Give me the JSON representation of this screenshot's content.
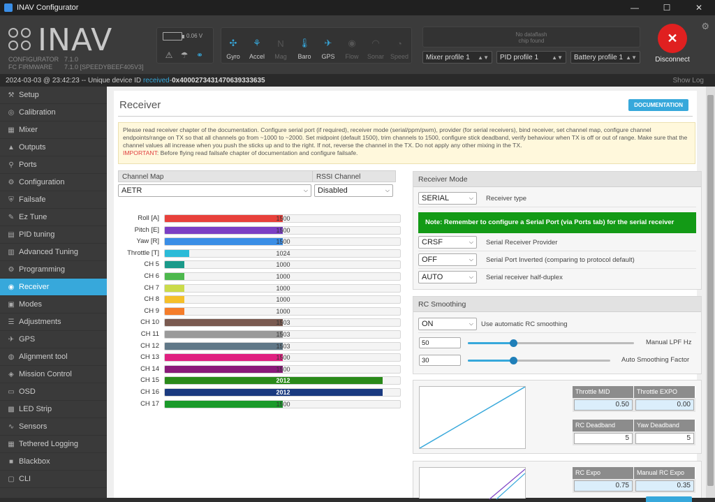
{
  "window": {
    "title": "INAV Configurator",
    "minimize": "—",
    "maximize": "☐",
    "close": "✕"
  },
  "header": {
    "brand": "INAV",
    "configurator_label": "CONFIGURATOR",
    "configurator_version": "7.1.0",
    "firmware_label": "FC FIRMWARE",
    "firmware_version": "7.1.0 [SPEEDYBEEF405V3]",
    "battery_voltage": "0.06 V",
    "sensors": [
      {
        "label": "Gyro",
        "icon": "gyro-icon",
        "state": "on"
      },
      {
        "label": "Accel",
        "icon": "accel-icon",
        "state": "on"
      },
      {
        "label": "Mag",
        "icon": "mag-icon",
        "state": "off"
      },
      {
        "label": "Baro",
        "icon": "baro-icon",
        "state": "on"
      },
      {
        "label": "GPS",
        "icon": "gps-icon",
        "state": "on"
      },
      {
        "label": "Flow",
        "icon": "flow-icon",
        "state": "off"
      },
      {
        "label": "Sonar",
        "icon": "sonar-icon",
        "state": "off"
      },
      {
        "label": "Speed",
        "icon": "speed-icon",
        "state": "off"
      }
    ],
    "dataflash_line1": "No dataflash",
    "dataflash_line2": "chip found",
    "mixer_profile": "Mixer profile 1",
    "pid_profile": "PID profile 1",
    "battery_profile": "Battery profile 1",
    "disconnect_label": "Disconnect"
  },
  "status": {
    "prefix": "2024-03-03 @ 23:42:23 -- Unique device ID ",
    "received": "received",
    "sep": " - ",
    "device_id": "0x4000273431470639333635",
    "show_log": "Show Log"
  },
  "sidebar": {
    "items": [
      {
        "label": "Setup",
        "icon": "wrench-icon",
        "glyph": "⚒"
      },
      {
        "label": "Calibration",
        "icon": "calibration-icon",
        "glyph": "◎"
      },
      {
        "label": "Mixer",
        "icon": "mixer-icon",
        "glyph": "▦"
      },
      {
        "label": "Outputs",
        "icon": "outputs-icon",
        "glyph": "▲"
      },
      {
        "label": "Ports",
        "icon": "ports-icon",
        "glyph": "⚲"
      },
      {
        "label": "Configuration",
        "icon": "gear-icon",
        "glyph": "⚙"
      },
      {
        "label": "Failsafe",
        "icon": "failsafe-icon",
        "glyph": "⛨"
      },
      {
        "label": "Ez Tune",
        "icon": "eztune-icon",
        "glyph": "✎"
      },
      {
        "label": "PID tuning",
        "icon": "pid-icon",
        "glyph": "▤"
      },
      {
        "label": "Advanced Tuning",
        "icon": "advanced-tuning-icon",
        "glyph": "▥"
      },
      {
        "label": "Programming",
        "icon": "programming-icon",
        "glyph": "⚙"
      },
      {
        "label": "Receiver",
        "icon": "receiver-icon",
        "glyph": "◉"
      },
      {
        "label": "Modes",
        "icon": "modes-icon",
        "glyph": "▣"
      },
      {
        "label": "Adjustments",
        "icon": "adjustments-icon",
        "glyph": "☰"
      },
      {
        "label": "GPS",
        "icon": "gps-icon",
        "glyph": "✈"
      },
      {
        "label": "Alignment tool",
        "icon": "alignment-icon",
        "glyph": "◍"
      },
      {
        "label": "Mission Control",
        "icon": "mission-icon",
        "glyph": "◈"
      },
      {
        "label": "OSD",
        "icon": "osd-icon",
        "glyph": "▭"
      },
      {
        "label": "LED Strip",
        "icon": "led-icon",
        "glyph": "▩"
      },
      {
        "label": "Sensors",
        "icon": "sensors-icon",
        "glyph": "∿"
      },
      {
        "label": "Tethered Logging",
        "icon": "tethered-logging-icon",
        "glyph": "▦"
      },
      {
        "label": "Blackbox",
        "icon": "blackbox-icon",
        "glyph": "■"
      },
      {
        "label": "CLI",
        "icon": "cli-icon",
        "glyph": "▢"
      }
    ],
    "active_index": 11
  },
  "receiver": {
    "title": "Receiver",
    "doc_button": "DOCUMENTATION",
    "notice": "Please read receiver chapter of the documentation. Configure serial port (if required), receiver mode (serial/ppm/pwm), provider (for serial receivers), bind receiver, set channel map, configure channel endpoints/range on TX so that all channels go from ~1000 to ~2000. Set midpoint (default 1500), trim channels to 1500, configure stick deadband, verify behaviour when TX is off or out of range. Make sure that the channel values all increase when you push the sticks up and to the right. If not, reverse the channel in the TX. Do not apply any other mixing in the TX.",
    "important_label": "IMPORTANT",
    "important_text": ": Before flying read failsafe chapter of documentation and configure failsafe.",
    "channel_map_label": "Channel Map",
    "channel_map_value": "AETR",
    "rssi_label": "RSSI Channel",
    "rssi_value": "Disabled",
    "channels": [
      {
        "label": "Roll [A]",
        "value": 1500,
        "color": "#e8413b"
      },
      {
        "label": "Pitch [E]",
        "value": 1500,
        "color": "#7b3fc4"
      },
      {
        "label": "Yaw [R]",
        "value": 1500,
        "color": "#3a8ee6"
      },
      {
        "label": "Throttle [T]",
        "value": 1024,
        "color": "#2bbbd8"
      },
      {
        "label": "CH 5",
        "value": 1000,
        "color": "#1a9a8a"
      },
      {
        "label": "CH 6",
        "value": 1000,
        "color": "#4db84d"
      },
      {
        "label": "CH 7",
        "value": 1000,
        "color": "#cbdb4a"
      },
      {
        "label": "CH 8",
        "value": 1000,
        "color": "#f5c02a"
      },
      {
        "label": "CH 9",
        "value": 1000,
        "color": "#f57d2a"
      },
      {
        "label": "CH 10",
        "value": 1503,
        "color": "#7a5a50"
      },
      {
        "label": "CH 11",
        "value": 1503,
        "color": "#9a9a9a"
      },
      {
        "label": "CH 12",
        "value": 1503,
        "color": "#607888"
      },
      {
        "label": "CH 13",
        "value": 1500,
        "color": "#e02080"
      },
      {
        "label": "CH 14",
        "value": 1500,
        "color": "#8a1a7a"
      },
      {
        "label": "CH 15",
        "value": 2012,
        "color": "#2a8a1a"
      },
      {
        "label": "CH 16",
        "value": 2012,
        "color": "#1a3a80"
      },
      {
        "label": "CH 17",
        "value": 1500,
        "color": "#1a9a2a"
      }
    ],
    "mode": {
      "title": "Receiver Mode",
      "type_value": "SERIAL",
      "type_label": "Receiver type",
      "note": "Note: Remember to configure a Serial Port (via Ports tab) for the serial receiver",
      "provider_value": "CRSF",
      "provider_label": "Serial Receiver Provider",
      "inverted_value": "OFF",
      "inverted_label": "Serial Port Inverted (comparing to protocol default)",
      "halfduplex_value": "AUTO",
      "halfduplex_label": "Serial receiver half-duplex"
    },
    "smoothing": {
      "title": "RC Smoothing",
      "auto_value": "ON",
      "auto_label": "Use automatic RC smoothing",
      "lpf_value": "50",
      "lpf_label": "Manual LPF Hz",
      "factor_value": "30",
      "factor_label": "Auto Smoothing Factor"
    },
    "throttle": {
      "mid_label": "Throttle MID",
      "mid_value": "0.50",
      "expo_label": "Throttle EXPO",
      "expo_value": "0.00",
      "rc_deadband_label": "RC Deadband",
      "rc_deadband_value": "5",
      "yaw_deadband_label": "Yaw Deadband",
      "yaw_deadband_value": "5"
    },
    "expo": {
      "rc_expo_label": "RC Expo",
      "rc_expo_value": "0.75",
      "manual_rc_expo_label": "Manual RC Expo",
      "manual_rc_expo_value": "0.35"
    }
  }
}
